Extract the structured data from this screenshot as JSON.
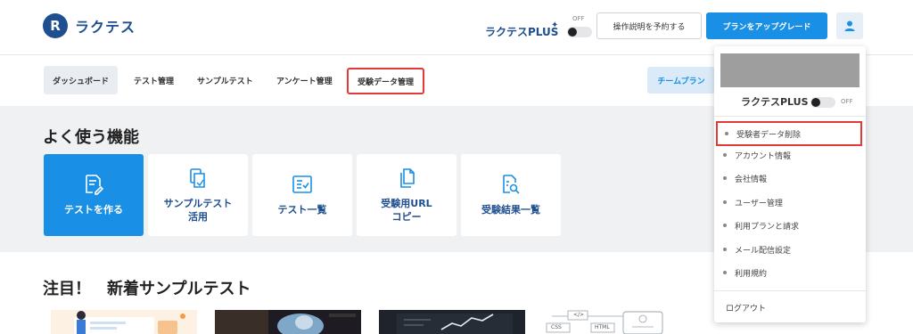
{
  "header": {
    "logo_mark": "R",
    "logo_text": "ラクテス",
    "plus_label": "ラクテスPLUS",
    "plus_star": "✦",
    "plus_toggle_state": "OFF",
    "reserve_label": "操作説明を予約する",
    "upgrade_label": "プランをアップグレード",
    "user_icon": "user-icon"
  },
  "nav": {
    "items": [
      {
        "label": "ダッシュボード"
      },
      {
        "label": "テスト管理"
      },
      {
        "label": "サンプルテスト"
      },
      {
        "label": "アンケート管理"
      },
      {
        "label": "受験データ管理"
      }
    ],
    "team_label": "チームプラン"
  },
  "main": {
    "features_title": "よく使う機能",
    "features": [
      {
        "label": "テストを作る",
        "icon": "edit-doc-icon"
      },
      {
        "label": "サンプルテスト\n活用",
        "icon": "copy-doc-icon"
      },
      {
        "label": "テスト一覧",
        "icon": "checklist-icon"
      },
      {
        "label": "受験用URL\nコピー",
        "icon": "files-icon"
      },
      {
        "label": "受験結果一覧",
        "icon": "search-doc-icon"
      }
    ],
    "new_samples_title": "注目！　新着サンプルテスト",
    "thumbnails": [
      {
        "name": "sample-thumb-1"
      },
      {
        "name": "sample-thumb-2"
      },
      {
        "name": "sample-thumb-3"
      },
      {
        "name": "sample-thumb-4",
        "tags": [
          "</>",
          "CSS",
          "HTML"
        ]
      }
    ]
  },
  "dropdown": {
    "plus_label": "ラクテスPLUS",
    "plus_toggle_state": "OFF",
    "items": [
      {
        "label": "受験者データ削除"
      },
      {
        "label": "アカウント情報"
      },
      {
        "label": "会社情報"
      },
      {
        "label": "ユーザー管理"
      },
      {
        "label": "利用プランと請求"
      },
      {
        "label": "メール配信設定"
      },
      {
        "label": "利用規約"
      }
    ],
    "logout_label": "ログアウト"
  },
  "colors": {
    "primary": "#1a8fe6",
    "brand": "#1f4f8f",
    "highlight": "#e53935"
  }
}
